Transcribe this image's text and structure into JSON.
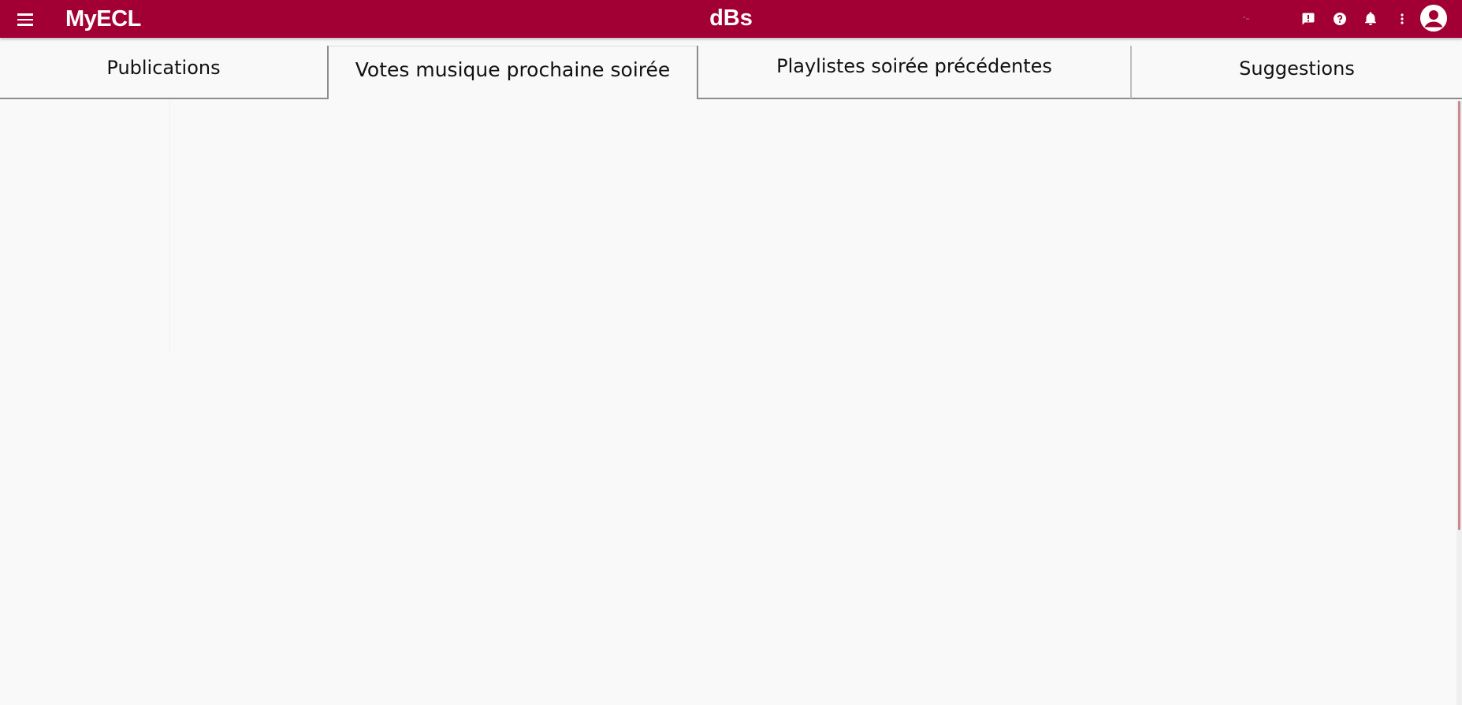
{
  "header": {
    "app_name": "MyECL",
    "page_title": "dBs",
    "background_color": "#a20034",
    "icons": [
      "menu-icon",
      "feedback-icon",
      "help-icon",
      "notifications-icon",
      "more-vert-icon",
      "account-icon"
    ]
  },
  "tabs": [
    {
      "label": "Publications",
      "selected": false
    },
    {
      "label": "Votes musique prochaine soirée",
      "selected": true
    },
    {
      "label": "Playlistes soirée précédentes",
      "selected": false
    },
    {
      "label": "Suggestions",
      "selected": false
    }
  ]
}
